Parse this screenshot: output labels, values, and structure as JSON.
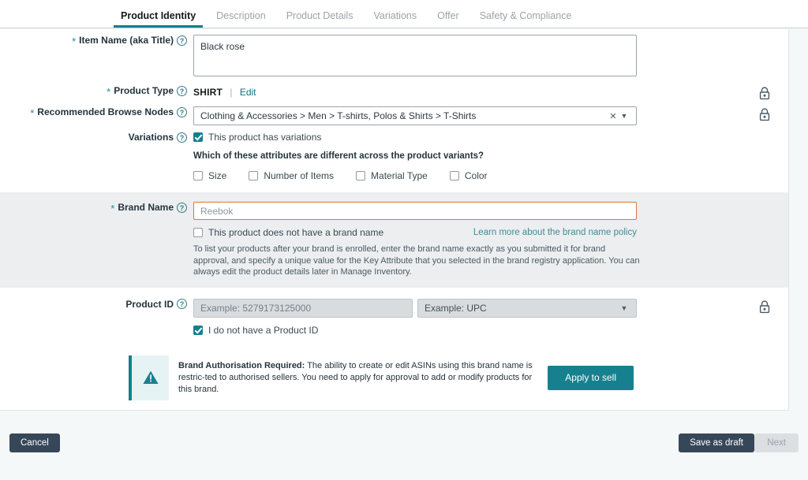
{
  "tabs": [
    {
      "label": "Product Identity",
      "active": true
    },
    {
      "label": "Description",
      "active": false
    },
    {
      "label": "Product Details",
      "active": false
    },
    {
      "label": "Variations",
      "active": false
    },
    {
      "label": "Offer",
      "active": false
    },
    {
      "label": "Safety & Compliance",
      "active": false
    }
  ],
  "form": {
    "item_name": {
      "label": "Item Name (aka Title)",
      "required": true,
      "value": "Black rose",
      "help_icon": "question-circle-icon"
    },
    "product_type": {
      "label": "Product Type",
      "required": true,
      "value": "SHIRT",
      "separator": "|",
      "edit_link": "Edit"
    },
    "browse_nodes": {
      "label": "Recommended Browse Nodes",
      "required": true,
      "value": "Clothing & Accessories > Men > T-shirts, Polos & Shirts > T-Shirts",
      "clear_icon": "✕",
      "chevron_icon": "▼",
      "lock_icon": "lock-closed-icon"
    },
    "variations": {
      "label": "Variations",
      "required": false,
      "has_variations_label": "This product has variations",
      "has_variations_checked": true,
      "question": "Which of these attributes are different across the product variants?",
      "attributes": [
        {
          "label": "Size",
          "checked": false
        },
        {
          "label": "Number of Items",
          "checked": false
        },
        {
          "label": "Material Type",
          "checked": false
        },
        {
          "label": "Color",
          "checked": false
        }
      ]
    },
    "brand_name": {
      "label": "Brand Name",
      "required": true,
      "placeholder": "Reebok",
      "value": "",
      "no_brand_label": "This product does not have a brand name",
      "no_brand_checked": false,
      "policy_link": "Learn more about the brand name policy",
      "help_text": "To list your products after your brand is enrolled, enter the brand name exactly as you submitted it for brand approval, and specify a unique value for the Key Attribute that you selected in the brand registry application. You can always edit the product details later in Manage Inventory."
    },
    "product_id": {
      "label": "Product ID",
      "required": false,
      "value_placeholder": "Example: 5279173125000",
      "type_placeholder": "Example: UPC",
      "chevron_icon": "▼",
      "no_id_label": "I do not have a Product ID",
      "no_id_checked": true,
      "lock_icon": "lock-closed-icon"
    }
  },
  "alert": {
    "icon": "warning-triangle-icon",
    "title": "Brand Authorisation Required:",
    "message": "The ability to create or edit ASINs using this brand name is restric-ted to authorised sellers. You need to apply for approval to add or modify products for this brand.",
    "button_label": "Apply to sell"
  },
  "footer": {
    "cancel_label": "Cancel",
    "save_draft_label": "Save as draft",
    "next_label": "Next"
  },
  "colors": {
    "accent_teal": "#12808f",
    "error_border": "#d6793f",
    "dark_button": "#37475a",
    "band_grey": "#eceef0",
    "page_bg": "#f4f8f9"
  }
}
